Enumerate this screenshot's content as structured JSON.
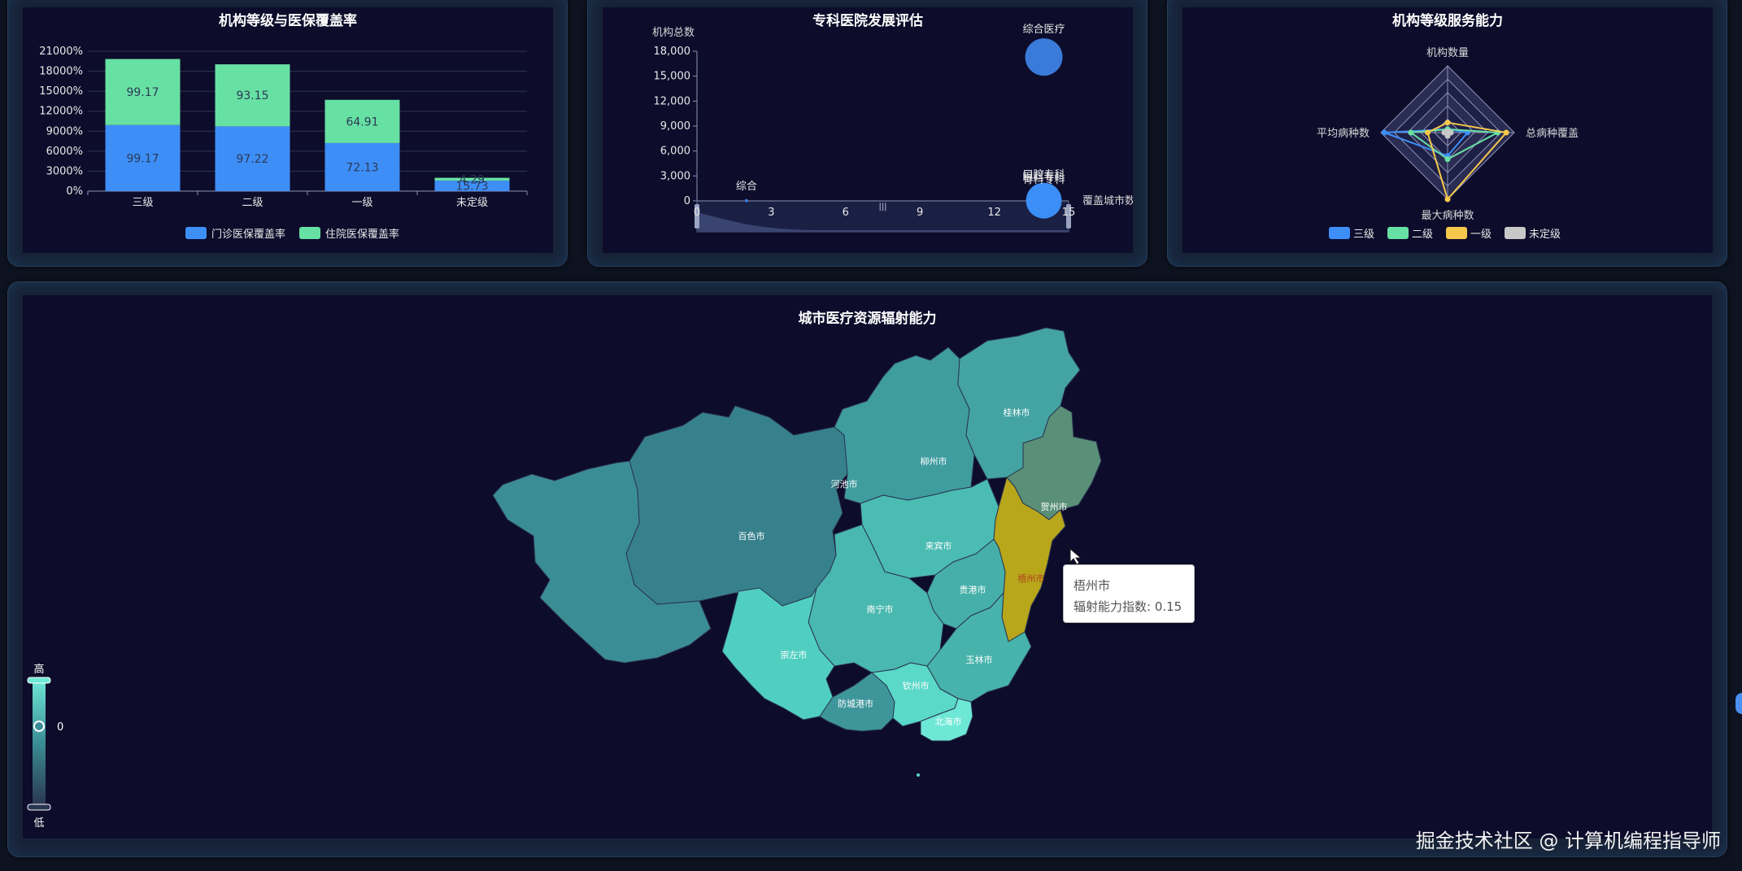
{
  "bar_panel": {
    "title": "机构等级与医保覆盖率",
    "legend": [
      {
        "name": "门诊医保覆盖率",
        "color": "#3e8ef7"
      },
      {
        "name": "住院医保覆盖率",
        "color": "#67e0a3"
      }
    ]
  },
  "bubble_panel": {
    "title": "专科医院发展评估",
    "ylabel": "机构总数",
    "xlabel": "覆盖城市数"
  },
  "radar_panel": {
    "title": "机构等级服务能力",
    "indicators": [
      "机构数量",
      "总病种覆盖",
      "最大病种数",
      "平均病种数"
    ],
    "legend": [
      {
        "name": "三级",
        "color": "#3e8ef7"
      },
      {
        "name": "二级",
        "color": "#67e0a3"
      },
      {
        "name": "一级",
        "color": "#f5c84c"
      },
      {
        "name": "未定级",
        "color": "#c8c8c8"
      }
    ]
  },
  "map_panel": {
    "title": "城市医疗资源辐射能力",
    "visualmap": {
      "high": "高",
      "low": "低",
      "value": "0"
    },
    "tooltip": {
      "city": "梧州市",
      "label": "辐射能力指数: 0.15"
    }
  },
  "watermark": "掘金技术社区 @ 计算机编程指导师",
  "chart_data": [
    {
      "type": "bar",
      "title": "机构等级与医保覆盖率",
      "categories": [
        "三级",
        "二级",
        "一级",
        "未定级"
      ],
      "series": [
        {
          "name": "门诊医保覆盖率",
          "values": [
            99.17,
            97.22,
            72.13,
            15.73
          ],
          "labels": [
            "99.17",
            "97.22",
            "72.13",
            "15.73"
          ]
        },
        {
          "name": "住院医保覆盖率",
          "values": [
            99.17,
            93.15,
            64.91,
            4.29
          ],
          "labels": [
            "99.17",
            "93.15",
            "64.91",
            "4.29"
          ]
        }
      ],
      "stacked": true,
      "yticks": [
        "0%",
        "3000%",
        "6000%",
        "9000%",
        "12000%",
        "15000%",
        "18000%",
        "21000%"
      ],
      "ylim": [
        0,
        210
      ]
    },
    {
      "type": "scatter",
      "title": "专科医院发展评估",
      "xlabel": "覆盖城市数",
      "ylabel": "机构总数",
      "xticks": [
        "0",
        "3",
        "6",
        "9",
        "12",
        "15"
      ],
      "yticks": [
        "0",
        "3,000",
        "6,000",
        "9,000",
        "12,000",
        "15,000",
        "18,000"
      ],
      "xlim": [
        0,
        15
      ],
      "ylim": [
        0,
        18000
      ],
      "points": [
        {
          "name": "综合医疗",
          "x": 14,
          "y": 17300,
          "size": 46
        },
        {
          "name": "综合",
          "x": 2,
          "y": 20,
          "size": 4
        },
        {
          "name": "口腔专科",
          "x": 14,
          "y": 30,
          "size": 44
        },
        {
          "name": "眼科专科",
          "x": 14,
          "y": 20,
          "size": 4
        },
        {
          "name": "骨科专科",
          "x": 14,
          "y": 10,
          "size": 4
        }
      ]
    },
    {
      "type": "radar",
      "title": "机构等级服务能力",
      "indicators": [
        "机构数量",
        "总病种覆盖",
        "最大病种数",
        "平均病种数"
      ],
      "series": [
        {
          "name": "三级",
          "values": [
            0.05,
            0.3,
            0.35,
            0.95
          ]
        },
        {
          "name": "二级",
          "values": [
            0.05,
            0.75,
            0.4,
            0.55
          ]
        },
        {
          "name": "一级",
          "values": [
            0.15,
            0.88,
            1.0,
            0.3
          ]
        },
        {
          "name": "未定级",
          "values": [
            0.02,
            0.05,
            0.05,
            0.05
          ]
        }
      ]
    },
    {
      "type": "map",
      "title": "城市医疗资源辐射能力",
      "regions": [
        {
          "name": "桂林市",
          "value": 0.55,
          "color": "#44a3a3"
        },
        {
          "name": "柳州市",
          "value": 0.5,
          "color": "#3f9c9f"
        },
        {
          "name": "河池市",
          "value": 0.35,
          "color": "#37818c"
        },
        {
          "name": "贺州市",
          "value": 0.3,
          "color": "#5a8f78"
        },
        {
          "name": "百色市",
          "value": 0.4,
          "color": "#3b8d95"
        },
        {
          "name": "来宾市",
          "value": 0.65,
          "color": "#4bbcb2"
        },
        {
          "name": "梧州市",
          "value": 0.15,
          "color": "#b8a61b"
        },
        {
          "name": "贵港市",
          "value": 0.6,
          "color": "#46afa9"
        },
        {
          "name": "南宁市",
          "value": 0.7,
          "color": "#49b8af"
        },
        {
          "name": "崇左市",
          "value": 0.75,
          "color": "#50cfc0"
        },
        {
          "name": "玉林市",
          "value": 0.6,
          "color": "#47b3ab"
        },
        {
          "name": "防城港市",
          "value": 0.45,
          "color": "#3e969b"
        },
        {
          "name": "钦州市",
          "value": 0.85,
          "color": "#5ad8c8"
        },
        {
          "name": "北海市",
          "value": 0.95,
          "color": "#6ee8d6"
        }
      ]
    }
  ]
}
